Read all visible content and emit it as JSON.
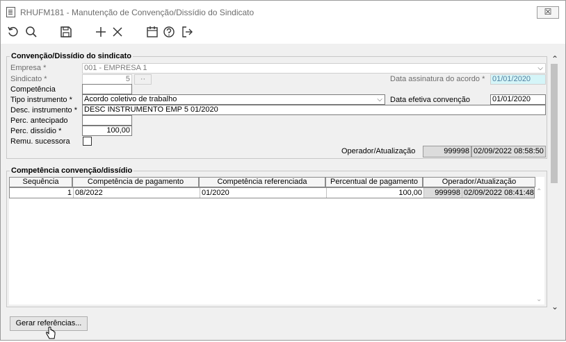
{
  "window": {
    "title": "RHUFM181 - Manutenção de Convenção/Dissídio do Sindicato",
    "close_label": "☒"
  },
  "toolbar": {
    "icons": [
      "undo-icon",
      "search-icon",
      "save-icon",
      "add-icon",
      "delete-icon",
      "calendar-icon",
      "help-icon",
      "exit-icon"
    ]
  },
  "section1": {
    "legend": "Convenção/Dissídio do sindicato",
    "empresa": {
      "label": "Empresa *",
      "value": "001 - EMPRESA 1"
    },
    "sindicato": {
      "label": "Sindicato *",
      "value": "5",
      "lookup": "··"
    },
    "data_assinatura": {
      "label": "Data assinatura do acordo *",
      "value": "01/01/2020"
    },
    "competencia": {
      "label": "Competência",
      "value": ""
    },
    "tipo_instrumento": {
      "label": "Tipo instrumento *",
      "value": "Acordo coletivo de trabalho"
    },
    "data_efetiva": {
      "label": "Data efetiva convenção",
      "value": "01/01/2020"
    },
    "desc_instrumento": {
      "label": "Desc. instrumento *",
      "value": "DESC INSTRUMENTO  EMP 5 01/2020"
    },
    "perc_antecipado": {
      "label": "Perc. antecipado",
      "value": ""
    },
    "perc_dissidio": {
      "label": "Perc. dissídio *",
      "value": "100,00"
    },
    "remu_sucessora": {
      "label": "Remu. sucessora",
      "checked": false
    },
    "operador": {
      "label": "Operador/Atualização",
      "user": "999998",
      "datetime": "02/09/2022 08:58:50"
    }
  },
  "section2": {
    "legend": "Competência convenção/dissídio",
    "columns": [
      "Sequência",
      "Competência de pagamento",
      "Competência referenciada",
      "Percentual de pagamento",
      "Operador/Atualização"
    ],
    "rows": [
      {
        "sequencia": "1",
        "comp_pagamento": "08/2022",
        "comp_referenciada": "01/2020",
        "percentual": "100,00",
        "operador": "999998",
        "datetime": "02/09/2022 08:41:48"
      }
    ]
  },
  "buttons": {
    "gerar": "Gerar referências..."
  }
}
